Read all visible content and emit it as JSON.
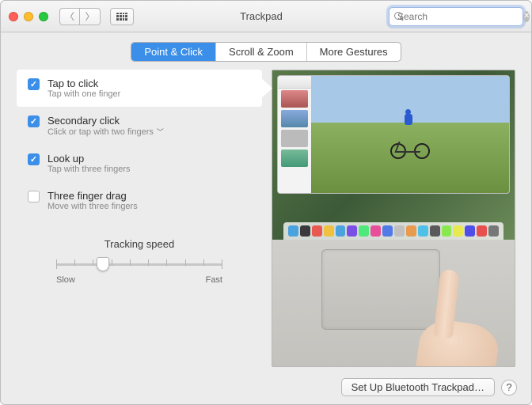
{
  "window": {
    "title": "Trackpad"
  },
  "search": {
    "placeholder": "Search"
  },
  "tabs": [
    {
      "label": "Point & Click",
      "active": true
    },
    {
      "label": "Scroll & Zoom",
      "active": false
    },
    {
      "label": "More Gestures",
      "active": false
    }
  ],
  "options": [
    {
      "title": "Tap to click",
      "subtitle": "Tap with one finger",
      "checked": true,
      "selected": true,
      "dropdown": false
    },
    {
      "title": "Secondary click",
      "subtitle": "Click or tap with two fingers",
      "checked": true,
      "selected": false,
      "dropdown": true
    },
    {
      "title": "Look up",
      "subtitle": "Tap with three fingers",
      "checked": true,
      "selected": false,
      "dropdown": false
    },
    {
      "title": "Three finger drag",
      "subtitle": "Move with three fingers",
      "checked": false,
      "selected": false,
      "dropdown": false
    }
  ],
  "slider": {
    "title": "Tracking speed",
    "min_label": "Slow",
    "max_label": "Fast",
    "ticks": 10,
    "value": 3
  },
  "footer": {
    "bt_button": "Set Up Bluetooth Trackpad…"
  },
  "dock_colors": [
    "#4aa3df",
    "#3a3a3a",
    "#e85a4f",
    "#f0c040",
    "#4aa3df",
    "#7a4fe8",
    "#4fe87a",
    "#e84f9a",
    "#4f7ae8",
    "#c0c0c0",
    "#e89a4f",
    "#4fc0e8",
    "#5a5a5a",
    "#8ae84f",
    "#e8e84f",
    "#4f4fe8",
    "#e84f4f",
    "#777"
  ]
}
